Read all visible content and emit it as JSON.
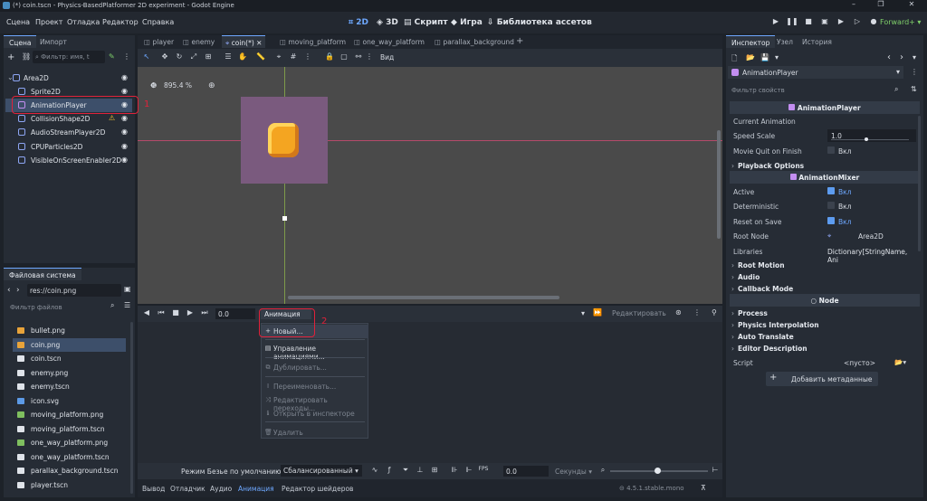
{
  "window": {
    "title": "(*) coin.tscn - Physics-BasedPlatformer 2D experiment - Godot Engine",
    "controls": [
      "–",
      "❐",
      "✕"
    ]
  },
  "menu": [
    "Сцена",
    "Проект",
    "Отладка",
    "Редактор",
    "Справка"
  ],
  "modes": {
    "m2d": "2D",
    "m3d": "3D",
    "script": "Скрипт",
    "game": "Игра",
    "assets": "Библиотека ассетов"
  },
  "renderer": "Forward+",
  "scene_dock": {
    "tabs": [
      "Сцена",
      "Импорт"
    ],
    "filter_placeholder": "Фильтр: имя, t",
    "nodes": [
      {
        "name": "Area2D",
        "icon_color": "#8da5f3",
        "warning": false
      },
      {
        "name": "Sprite2D",
        "icon_color": "#8da5f3",
        "warning": false
      },
      {
        "name": "AnimationPlayer",
        "icon_color": "#c38ef1",
        "warning": false
      },
      {
        "name": "CollisionShape2D",
        "icon_color": "#8da5f3",
        "warning": true
      },
      {
        "name": "AudioStreamPlayer2D",
        "icon_color": "#8da5f3",
        "warning": false
      },
      {
        "name": "CPUParticles2D",
        "icon_color": "#8da5f3",
        "warning": false
      },
      {
        "name": "VisibleOnScreenEnabler2D",
        "icon_color": "#8da5f3",
        "warning": false
      }
    ]
  },
  "filesystem": {
    "tab": "Файловая система",
    "path": "res://coin.png",
    "filter_placeholder": "Фильтр файлов",
    "files": [
      {
        "name": "bullet.png",
        "color": "#e8a33a"
      },
      {
        "name": "coin.png",
        "color": "#e8a33a"
      },
      {
        "name": "coin.tscn",
        "color": "#dfe3e9"
      },
      {
        "name": "enemy.png",
        "color": "#dfe3e9"
      },
      {
        "name": "enemy.tscn",
        "color": "#dfe3e9"
      },
      {
        "name": "icon.svg",
        "color": "#5c9ae6"
      },
      {
        "name": "moving_platform.png",
        "color": "#7fbf5f"
      },
      {
        "name": "moving_platform.tscn",
        "color": "#dfe3e9"
      },
      {
        "name": "one_way_platform.png",
        "color": "#7fbf5f"
      },
      {
        "name": "one_way_platform.tscn",
        "color": "#dfe3e9"
      },
      {
        "name": "parallax_background.tscn",
        "color": "#dfe3e9"
      },
      {
        "name": "player.tscn",
        "color": "#dfe3e9"
      }
    ]
  },
  "editor_tabs": [
    "player",
    "enemy",
    "coin(*)",
    "moving_platform",
    "one_way_platform",
    "parallax_background"
  ],
  "viewport": {
    "zoom": "895.4 %",
    "view_menu": "Вид"
  },
  "animation_panel": {
    "time": "0.0",
    "anim_button": "Анимация",
    "edit_button": "Редактировать",
    "bezier_label": "Режим Безье по умолчанию:",
    "bezier_value": "Сбалансированный",
    "snap_value": "0.0",
    "snap_unit": "Секунды"
  },
  "anim_menu": [
    {
      "label": "Новый...",
      "icon": "+",
      "disabled": false
    },
    {
      "label": "Управление анимациями...",
      "icon": "▤",
      "disabled": false
    },
    {
      "label": "Дублировать...",
      "icon": "⧉",
      "disabled": true
    },
    {
      "label": "Переименовать...",
      "icon": "I",
      "disabled": true
    },
    {
      "label": "Редактировать переходы...",
      "icon": "⤨",
      "disabled": true
    },
    {
      "label": "Открыть в инспекторе",
      "icon": "ℹ",
      "disabled": true
    },
    {
      "label": "Удалить",
      "icon": "🗑",
      "disabled": true
    }
  ],
  "bottom_tabs": [
    "Вывод",
    "Отладчик",
    "Аудио",
    "Анимация",
    "Редактор шейдеров"
  ],
  "version": "4.5.1.stable.mono",
  "inspector": {
    "tabs": [
      "Инспектор",
      "Узел",
      "История"
    ],
    "object": "AnimationPlayer",
    "filter_placeholder": "Фильтр свойств",
    "header_player": "AnimationPlayer",
    "current_animation": "Current Animation",
    "speed_scale_label": "Speed Scale",
    "speed_scale_value": "1.0",
    "speed_scale_fraction": 0.45,
    "movie_quit_label": "Movie Quit on Finish",
    "vkl": "Вкл",
    "playback_options": "Playback Options",
    "header_mixer": "AnimationMixer",
    "active_label": "Active",
    "deterministic_label": "Deterministic",
    "reset_label": "Reset on Save",
    "root_node_label": "Root Node",
    "root_node_value": "Area2D",
    "libraries_label": "Libraries",
    "libraries_value": "Dictionary[StringName, Ani",
    "root_motion": "Root Motion",
    "audio": "Audio",
    "callback_mode": "Callback Mode",
    "header_node": "Node",
    "process": "Process",
    "physics_interp": "Physics Interpolation",
    "auto_translate": "Auto Translate",
    "editor_description": "Editor Description",
    "script_label": "Script",
    "script_value": "<пусто>",
    "add_meta": "Добавить метаданные"
  },
  "annotations": [
    "1",
    "2"
  ],
  "colors": {
    "accent": "#6ea8ff",
    "annotation_red": "#e0223a",
    "sprite_bg": "#7a5a7e",
    "coin": "#f4a521"
  }
}
